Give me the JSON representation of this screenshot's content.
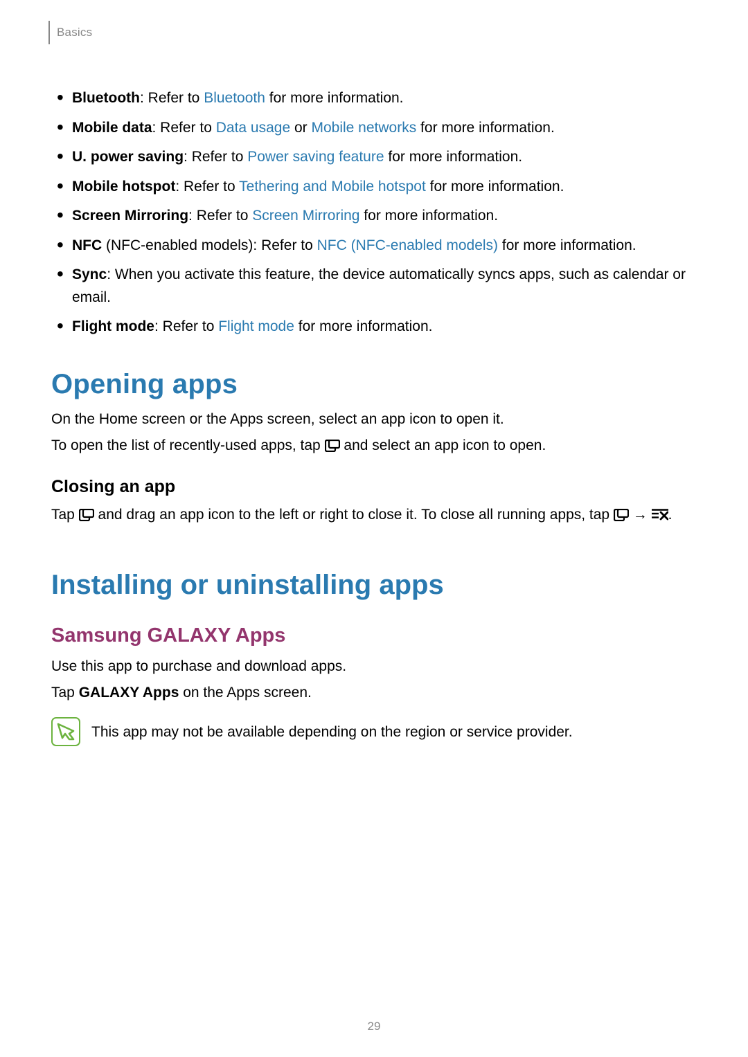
{
  "header": {
    "breadcrumb": "Basics"
  },
  "feature_list": [
    {
      "label": "Bluetooth",
      "pre": ": Refer to ",
      "links": [
        "Bluetooth"
      ],
      "join": "",
      "post": " for more information."
    },
    {
      "label": "Mobile data",
      "pre": ": Refer to ",
      "links": [
        "Data usage",
        "Mobile networks"
      ],
      "join": " or ",
      "post": " for more information."
    },
    {
      "label": "U. power saving",
      "pre": ": Refer to ",
      "links": [
        "Power saving feature"
      ],
      "join": "",
      "post": " for more information."
    },
    {
      "label": "Mobile hotspot",
      "pre": ": Refer to ",
      "links": [
        "Tethering and Mobile hotspot"
      ],
      "join": "",
      "post": " for more information."
    },
    {
      "label": "Screen Mirroring",
      "pre": ": Refer to ",
      "links": [
        "Screen Mirroring"
      ],
      "join": "",
      "post": " for more information."
    },
    {
      "label": "NFC",
      "qualifier": " (NFC-enabled models)",
      "pre": ": Refer to ",
      "links": [
        "NFC (NFC-enabled models)"
      ],
      "join": "",
      "post": " for more information."
    },
    {
      "label": "Sync",
      "text_full": ": When you activate this feature, the device automatically syncs apps, such as calendar or email."
    },
    {
      "label": "Flight mode",
      "pre": ": Refer to ",
      "links": [
        "Flight mode"
      ],
      "join": "",
      "post": " for more information."
    }
  ],
  "opening_apps": {
    "title": "Opening apps",
    "p1": "On the Home screen or the Apps screen, select an app icon to open it.",
    "p2a": "To open the list of recently-used apps, tap ",
    "p2b": " and select an app icon to open.",
    "closing_title": "Closing an app",
    "c1a": "Tap ",
    "c1b": " and drag an app icon to the left or right to close it. To close all running apps, tap ",
    "c1c": " → ",
    "c1d": "."
  },
  "installing": {
    "title": "Installing or uninstalling apps",
    "galaxy_title": "Samsung GALAXY Apps",
    "p1": "Use this app to purchase and download apps.",
    "p2a": "Tap ",
    "p2b": "GALAXY Apps",
    "p2c": " on the Apps screen.",
    "note": "This app may not be available depending on the region or service provider."
  },
  "page_number": "29",
  "icons": {
    "recent": "recent-apps-icon",
    "close_all": "close-all-icon",
    "note": "note-icon"
  }
}
